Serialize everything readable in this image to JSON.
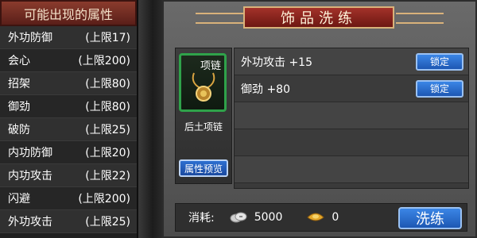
{
  "left_panel": {
    "title": "可能出现的属性",
    "attributes": [
      {
        "name": "外功防御",
        "limit": "(上限17)"
      },
      {
        "name": "会心",
        "limit": "(上限200)"
      },
      {
        "name": "招架",
        "limit": "(上限80)"
      },
      {
        "name": "御劲",
        "limit": "(上限80)"
      },
      {
        "name": "破防",
        "limit": "(上限25)"
      },
      {
        "name": "内功防御",
        "limit": "(上限20)"
      },
      {
        "name": "内功攻击",
        "limit": "(上限22)"
      },
      {
        "name": "闪避",
        "limit": "(上限200)"
      },
      {
        "name": "外功攻击",
        "limit": "(上限25)"
      }
    ]
  },
  "dialog": {
    "title": "饰品洗练",
    "item": {
      "type_label": "项链",
      "name": "后土项链",
      "icon": "necklace-icon",
      "preview_button": "属性预览"
    },
    "stats": [
      {
        "text": "外功攻击 +15",
        "lock_label": "锁定"
      },
      {
        "text": "御劲 +80",
        "lock_label": "锁定"
      },
      {
        "text": ""
      },
      {
        "text": ""
      },
      {
        "text": ""
      }
    ],
    "cost": {
      "label": "消耗:",
      "silver_icon": "silver-coins-icon",
      "silver_amount": "5000",
      "gold_icon": "gold-ingot-icon",
      "gold_amount": "0",
      "wash_button": "洗练"
    }
  },
  "colors": {
    "title_red": "#a3322a",
    "item_border_green": "#2fa24a",
    "button_blue": "#1d57b3"
  }
}
